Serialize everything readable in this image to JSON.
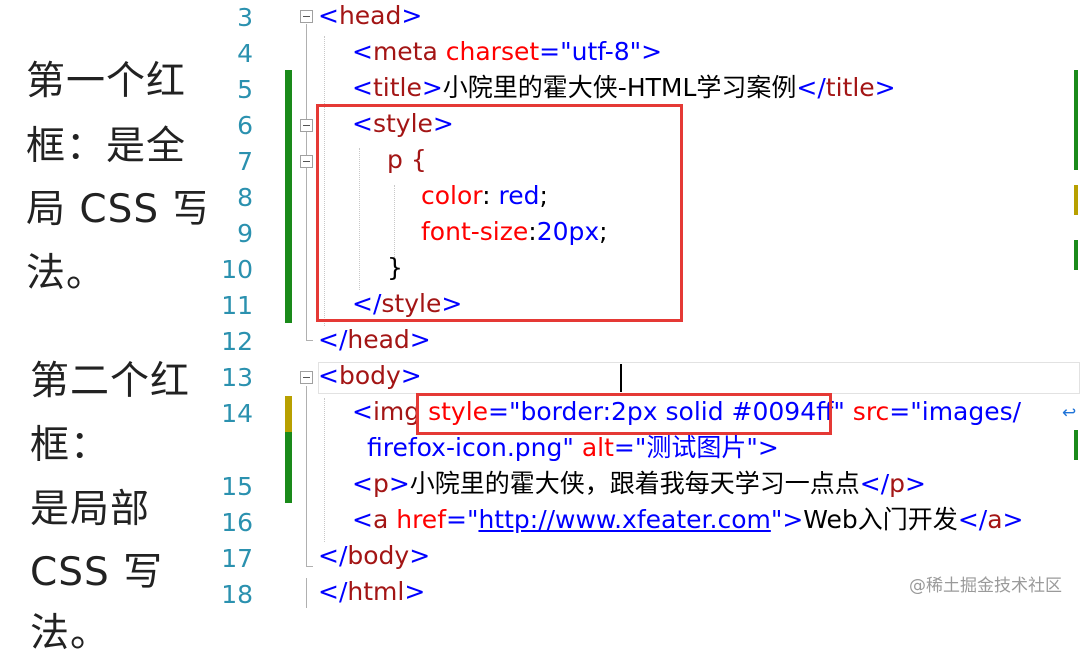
{
  "notes": {
    "line1": "第一个红",
    "line2": "框：是全",
    "line3": "局 CSS 写",
    "line4": "法。",
    "line5": "第二个红",
    "line6": "框：",
    "line7": "是局部",
    "line8": "CSS 写",
    "line9": "法。"
  },
  "editor": {
    "line_numbers": [
      "3",
      "4",
      "5",
      "6",
      "7",
      "8",
      "9",
      "10",
      "11",
      "12",
      "13",
      "14",
      "15",
      "16",
      "17",
      "18"
    ],
    "code": {
      "l3_tag": "head",
      "l4_tag": "meta",
      "l4_attr": "charset",
      "l4_val": "\"utf-8\"",
      "l5_tag_open": "title",
      "l5_text": "小院里的霍大侠-HTML学习案例",
      "l5_tag_close": "title",
      "l6_tag": "style",
      "l7_selector": "p {",
      "l8_prop": "color",
      "l8_val": "red",
      "l9_prop": "font-size",
      "l9_val": "20px",
      "l10_brace": "}",
      "l11_tag": "style",
      "l12_tag": "head",
      "l13_tag": "body",
      "l14_tag": "img",
      "l14_attr1": "style",
      "l14_val1_a": "\"border",
      "l14_val1_b": ":2px solid #0094ff\"",
      "l14_attr2": "src",
      "l14_val2": "\"images/",
      "l14b_val2": "firefox-icon.png\"",
      "l14b_attr3": "alt",
      "l14b_val3": "\"测试图片\"",
      "l15_tag_open": "p",
      "l15_text": "小院里的霍大侠，跟着我每天学习一点点",
      "l15_tag_close": "p",
      "l16_tag": "a",
      "l16_attr": "href",
      "l16_url": "http://www.xfeater.com",
      "l16_text": "Web入门开发",
      "l16_tag_close": "a",
      "l17_tag": "body",
      "l18_tag": "html"
    }
  },
  "watermark": "@稀土掘金技术社区",
  "colors": {
    "tag": "#a31515",
    "bracket": "#0000ff",
    "attribute": "#ff0000",
    "value": "#0000ff",
    "highlight_box": "#e53935",
    "line_number": "#2b91af",
    "change_saved": "#1a8a1a",
    "change_unsaved": "#b8a000"
  }
}
